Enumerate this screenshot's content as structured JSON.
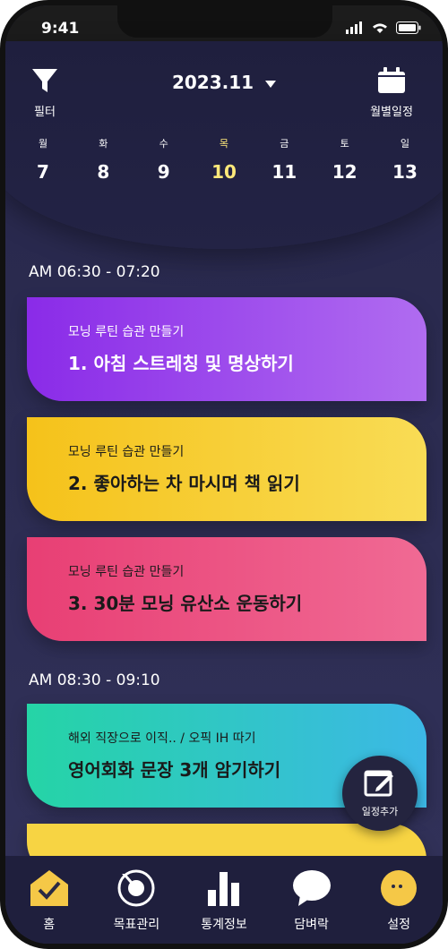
{
  "status": {
    "time": "9:41"
  },
  "header": {
    "filter_label": "필터",
    "month": "2023.11",
    "monthly_label": "월별일정"
  },
  "days": [
    {
      "dow": "월",
      "num": "7"
    },
    {
      "dow": "화",
      "num": "8"
    },
    {
      "dow": "수",
      "num": "9"
    },
    {
      "dow": "목",
      "num": "10"
    },
    {
      "dow": "금",
      "num": "11"
    },
    {
      "dow": "토",
      "num": "12"
    },
    {
      "dow": "일",
      "num": "13"
    }
  ],
  "blocks": [
    {
      "time": "AM 06:30 - 07:20",
      "cards": [
        {
          "sub": "모닝 루틴 습관 만들기",
          "title": "1. 아침 스트레칭 및 명상하기"
        },
        {
          "sub": "모닝 루틴 습관 만들기",
          "title": "2. 좋아하는 차 마시며 책 읽기"
        },
        {
          "sub": "모닝 루틴 습관 만들기",
          "title": "3. 30분 모닝 유산소 운동하기"
        }
      ]
    },
    {
      "time": "AM 08:30 - 09:10",
      "cards": [
        {
          "sub": "해외 직장으로 이직.. / 오픽 IH 따기",
          "title": "영어회화 문장 3개 암기하기"
        }
      ]
    }
  ],
  "fab": {
    "label": "일정추가"
  },
  "tabs": [
    {
      "label": "홈"
    },
    {
      "label": "목표관리"
    },
    {
      "label": "통계정보"
    },
    {
      "label": "담벼락"
    },
    {
      "label": "설정"
    }
  ],
  "colors": {
    "active_day": "#ffe97a",
    "card_purple": "#8a2be8",
    "card_yellow": "#f5c21a",
    "card_pink": "#e83f74",
    "card_teal": "#25d4a6"
  }
}
